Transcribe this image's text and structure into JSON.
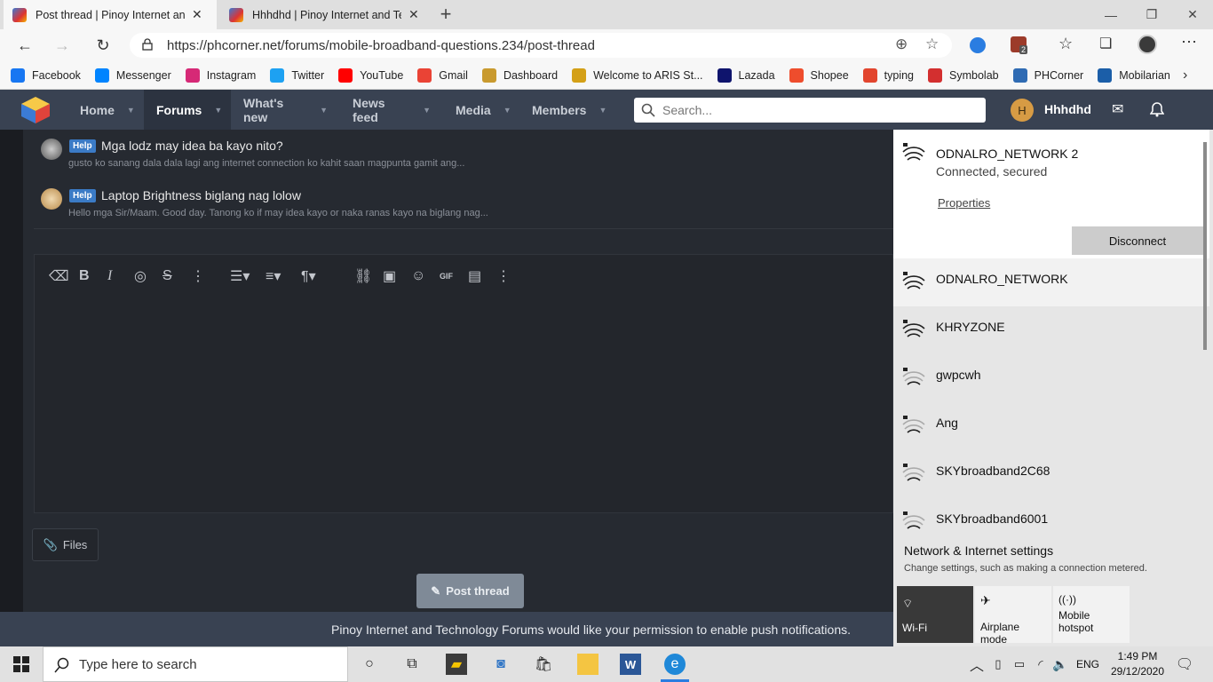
{
  "browser": {
    "tabs": [
      {
        "title": "Post thread | Pinoy Internet and",
        "active": true
      },
      {
        "title": "Hhhdhd | Pinoy Internet and Tec",
        "active": false
      }
    ],
    "url": "https://phcorner.net/forums/mobile-broadband-questions.234/post-thread",
    "bookmarks": [
      {
        "label": "Facebook",
        "color": "#1877f2"
      },
      {
        "label": "Messenger",
        "color": "#0084ff"
      },
      {
        "label": "Instagram",
        "color": "#d62976"
      },
      {
        "label": "Twitter",
        "color": "#1da1f2"
      },
      {
        "label": "YouTube",
        "color": "#ff0000"
      },
      {
        "label": "Gmail",
        "color": "#ea4335"
      },
      {
        "label": "Dashboard",
        "color": "#c99a2e"
      },
      {
        "label": "Welcome to ARIS St...",
        "color": "#d4a017"
      },
      {
        "label": "Lazada",
        "color": "#0f146d"
      },
      {
        "label": "Shopee",
        "color": "#ee4d2d"
      },
      {
        "label": "typing",
        "color": "#e2452e"
      },
      {
        "label": "Symbolab",
        "color": "#d32f2f"
      },
      {
        "label": "PHCorner",
        "color": "#2f6bb3"
      },
      {
        "label": "Mobilarian",
        "color": "#1b5ea8"
      }
    ],
    "ext_badge": "2"
  },
  "site": {
    "nav": [
      {
        "label": "Home",
        "selected": false
      },
      {
        "label": "Forums",
        "selected": true
      },
      {
        "label": "What's new",
        "selected": false
      },
      {
        "label": "News feed",
        "selected": false
      },
      {
        "label": "Media",
        "selected": false
      },
      {
        "label": "Members",
        "selected": false
      }
    ],
    "search_placeholder": "Search...",
    "user_initial": "H",
    "username": "Hhhdhd"
  },
  "threads": [
    {
      "tag": "Help",
      "title": "Mga lodz may idea ba kayo nito?",
      "snippet": "gusto ko sanang dala dala lagi ang internet connection ko kahit saan magpunta gamit ang..."
    },
    {
      "tag": "Help",
      "title": "Laptop Brightness biglang nag lolow",
      "snippet": "Hello mga Sir/Maam. Good day. Tanong ko if may idea kayo or naka ranas kayo na biglang nag..."
    }
  ],
  "editor": {
    "files_label": "Files",
    "post_button": "Post thread"
  },
  "push_notice": "Pinoy Internet and Technology Forums would like your permission to enable push notifications.",
  "network": {
    "connected": {
      "name": "ODNALRO_NETWORK 2",
      "status": "Connected, secured",
      "properties": "Properties",
      "disconnect": "Disconnect"
    },
    "available": [
      {
        "name": "ODNALRO_NETWORK",
        "strength": 4
      },
      {
        "name": "KHRYZONE",
        "strength": 4
      },
      {
        "name": "gwpcwh",
        "strength": 2
      },
      {
        "name": "Ang",
        "strength": 2
      },
      {
        "name": "SKYbroadband2C68",
        "strength": 2
      },
      {
        "name": "SKYbroadband6001",
        "strength": 2
      }
    ],
    "settings_title": "Network & Internet settings",
    "settings_desc": "Change settings, such as making a connection metered.",
    "quick_actions": [
      {
        "label": "Wi-Fi",
        "active": true
      },
      {
        "label": "Airplane mode",
        "active": false
      },
      {
        "label": "Mobile hotspot",
        "active": false
      }
    ]
  },
  "taskbar": {
    "search_placeholder": "Type here to search",
    "language": "ENG",
    "time": "1:49 PM",
    "date": "29/12/2020"
  }
}
